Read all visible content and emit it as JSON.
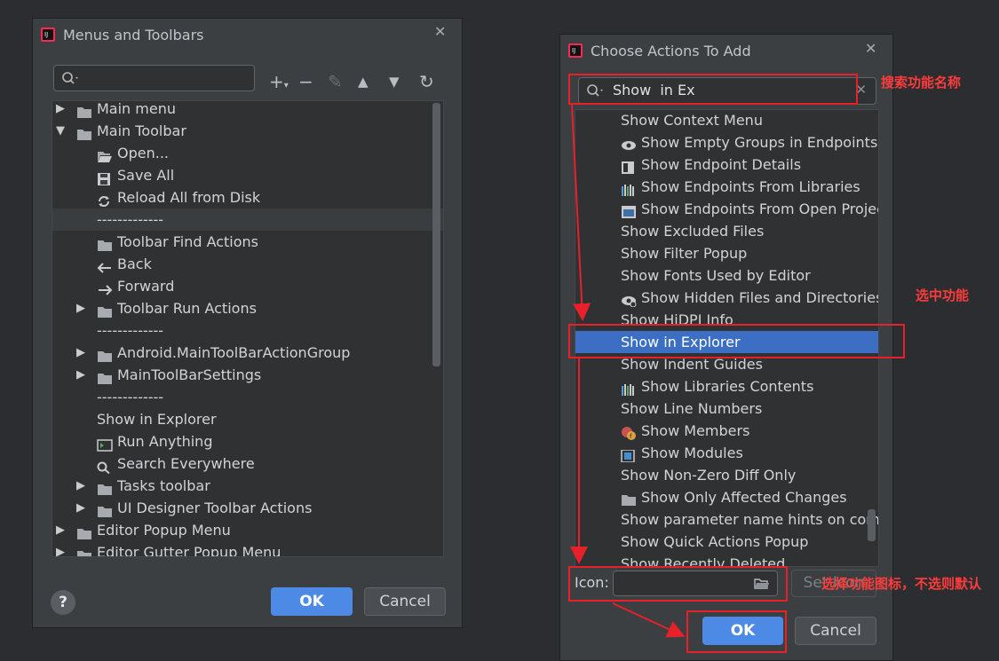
{
  "dialog1": {
    "title": "Menus and Toolbars",
    "search_value": "",
    "tree": [
      {
        "label": "Main menu",
        "depth": 0,
        "arrow": "right",
        "icon": "folder-icon"
      },
      {
        "label": "Main Toolbar",
        "depth": 0,
        "arrow": "down",
        "icon": "folder-icon"
      },
      {
        "label": "Open...",
        "depth": 1,
        "arrow": "",
        "icon": "open-folder-icon"
      },
      {
        "label": "Save All",
        "depth": 1,
        "arrow": "",
        "icon": "save-icon"
      },
      {
        "label": "Reload All from Disk",
        "depth": 1,
        "arrow": "",
        "icon": "reload-icon"
      },
      {
        "label": "-------------",
        "depth": 1,
        "arrow": "",
        "icon": "",
        "highlight": true
      },
      {
        "label": "Toolbar Find Actions",
        "depth": 1,
        "arrow": "",
        "icon": "folder-icon"
      },
      {
        "label": "Back",
        "depth": 1,
        "arrow": "",
        "icon": "back-arrow-icon"
      },
      {
        "label": "Forward",
        "depth": 1,
        "arrow": "",
        "icon": "forward-arrow-icon"
      },
      {
        "label": "Toolbar Run Actions",
        "depth": 1,
        "arrow": "right",
        "icon": "folder-icon"
      },
      {
        "label": "-------------",
        "depth": 1,
        "arrow": "",
        "icon": ""
      },
      {
        "label": "Android.MainToolBarActionGroup",
        "depth": 1,
        "arrow": "right",
        "icon": "folder-icon"
      },
      {
        "label": "MainToolBarSettings",
        "depth": 1,
        "arrow": "right",
        "icon": "folder-icon"
      },
      {
        "label": "-------------",
        "depth": 1,
        "arrow": "",
        "icon": ""
      },
      {
        "label": "Show in Explorer",
        "depth": 1,
        "arrow": "",
        "icon": ""
      },
      {
        "label": "Run Anything",
        "depth": 1,
        "arrow": "",
        "icon": "run-anything-icon"
      },
      {
        "label": "Search Everywhere",
        "depth": 1,
        "arrow": "",
        "icon": "search-icon"
      },
      {
        "label": "Tasks toolbar",
        "depth": 1,
        "arrow": "right",
        "icon": "folder-icon"
      },
      {
        "label": "UI Designer Toolbar Actions",
        "depth": 1,
        "arrow": "right",
        "icon": "folder-icon"
      },
      {
        "label": "Editor Popup Menu",
        "depth": 0,
        "arrow": "right",
        "icon": "folder-icon"
      },
      {
        "label": "Editor Gutter Popup Menu",
        "depth": 0,
        "arrow": "right",
        "icon": "folder-icon"
      }
    ],
    "ok_label": "OK",
    "cancel_label": "Cancel",
    "help_label": "?"
  },
  "dialog2": {
    "title": "Choose Actions To Add",
    "search_value": "Show  in Ex",
    "items": [
      {
        "label": "Show Context Menu",
        "icon": ""
      },
      {
        "label": "Show Empty Groups in Endpoints",
        "icon": "eye-icon"
      },
      {
        "label": "Show Endpoint Details",
        "icon": "details-panel-icon"
      },
      {
        "label": "Show Endpoints From Libraries",
        "icon": "libraries-icon"
      },
      {
        "label": "Show Endpoints From Open Projec",
        "icon": "window-icon"
      },
      {
        "label": "Show Excluded Files",
        "icon": ""
      },
      {
        "label": "Show Filter Popup",
        "icon": ""
      },
      {
        "label": "Show Fonts Used by Editor",
        "icon": ""
      },
      {
        "label": "Show Hidden Files and Directories",
        "icon": "hidden-eye-icon"
      },
      {
        "label": "Show HiDPI Info",
        "icon": ""
      },
      {
        "label": "Show in Explorer",
        "icon": "",
        "selected": true
      },
      {
        "label": "Show Indent Guides",
        "icon": ""
      },
      {
        "label": "Show Libraries Contents",
        "icon": "libraries-icon"
      },
      {
        "label": "Show Line Numbers",
        "icon": ""
      },
      {
        "label": "Show Members",
        "icon": "members-icon"
      },
      {
        "label": "Show Modules",
        "icon": "module-icon"
      },
      {
        "label": "Show Non-Zero Diff Only",
        "icon": ""
      },
      {
        "label": "Show Only Affected Changes",
        "icon": "folder-icon"
      },
      {
        "label": "Show parameter name hints on comp",
        "icon": ""
      },
      {
        "label": "Show Quick Actions Popup",
        "icon": ""
      },
      {
        "label": "Show Recently Deleted",
        "icon": ""
      }
    ],
    "icon_label": "Icon:",
    "icon_path_value": "",
    "set_icon_label": "Set Icon",
    "ok_label": "OK",
    "cancel_label": "Cancel"
  },
  "annotations": {
    "search_note": "搜索功能名称",
    "select_note": "选中功能",
    "icon_note": "选择功能图标，不选则默认"
  },
  "colors": {
    "accent": "#4d8ae6",
    "selection": "#3c6fc4",
    "annotation_red": "#e8202a"
  }
}
